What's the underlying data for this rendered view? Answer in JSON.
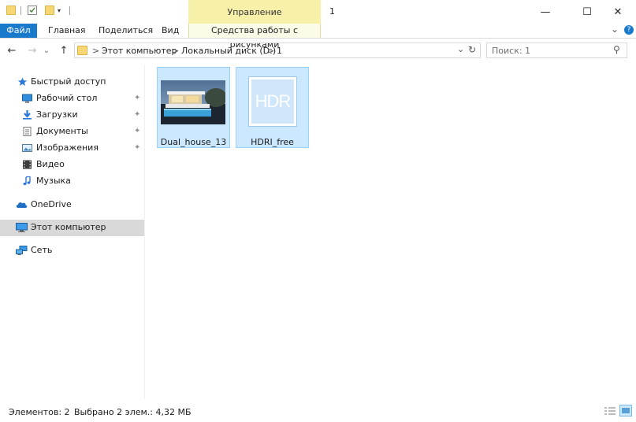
{
  "window": {
    "title": "1",
    "contextual_tab": "Управление",
    "minimize_glyph": "—",
    "maximize_glyph": "☐",
    "close_glyph": "✕"
  },
  "ribbon": {
    "tabs": [
      "Файл",
      "Главная",
      "Поделиться",
      "Вид"
    ],
    "tools_tab": "Средства работы с рисунками",
    "expand_glyph": "⌄"
  },
  "address": {
    "back_glyph": "←",
    "forward_glyph": "→",
    "recent_glyph": "⌄",
    "up_glyph": "↑",
    "breadcrumbs": [
      "Этот компьютер",
      "Локальный диск (D:)",
      "1"
    ],
    "separator": ">",
    "dropdown_glyph": "⌄",
    "refresh_glyph": "↻"
  },
  "search": {
    "placeholder": "Поиск: 1",
    "icon_glyph": "⚲"
  },
  "sidebar": {
    "quick_access": "Быстрый доступ",
    "items": [
      {
        "label": "Рабочий стол",
        "icon": "desktop-icon",
        "pinned": true
      },
      {
        "label": "Загрузки",
        "icon": "download-icon",
        "pinned": true
      },
      {
        "label": "Документы",
        "icon": "documents-icon",
        "pinned": true
      },
      {
        "label": "Изображения",
        "icon": "pictures-icon",
        "pinned": true
      },
      {
        "label": "Видео",
        "icon": "video-icon",
        "pinned": false
      },
      {
        "label": "Музыка",
        "icon": "music-icon",
        "pinned": false
      }
    ],
    "onedrive": "OneDrive",
    "this_pc": "Этот компьютер",
    "network": "Сеть",
    "pin_glyph": "📌"
  },
  "files": [
    {
      "name": "Dual_house_13",
      "thumbnail": "house-photo"
    },
    {
      "name": "HDRI_free",
      "thumbnail": "hdr-file-icon",
      "badge": "HDR"
    }
  ],
  "status": {
    "count": "Элементов: 2",
    "selected": "Выбрано 2 элем.: 4,32 МБ"
  },
  "colors": {
    "accent": "#1979ca",
    "selection": "#cce8ff",
    "contextual": "#f6f0a8"
  }
}
